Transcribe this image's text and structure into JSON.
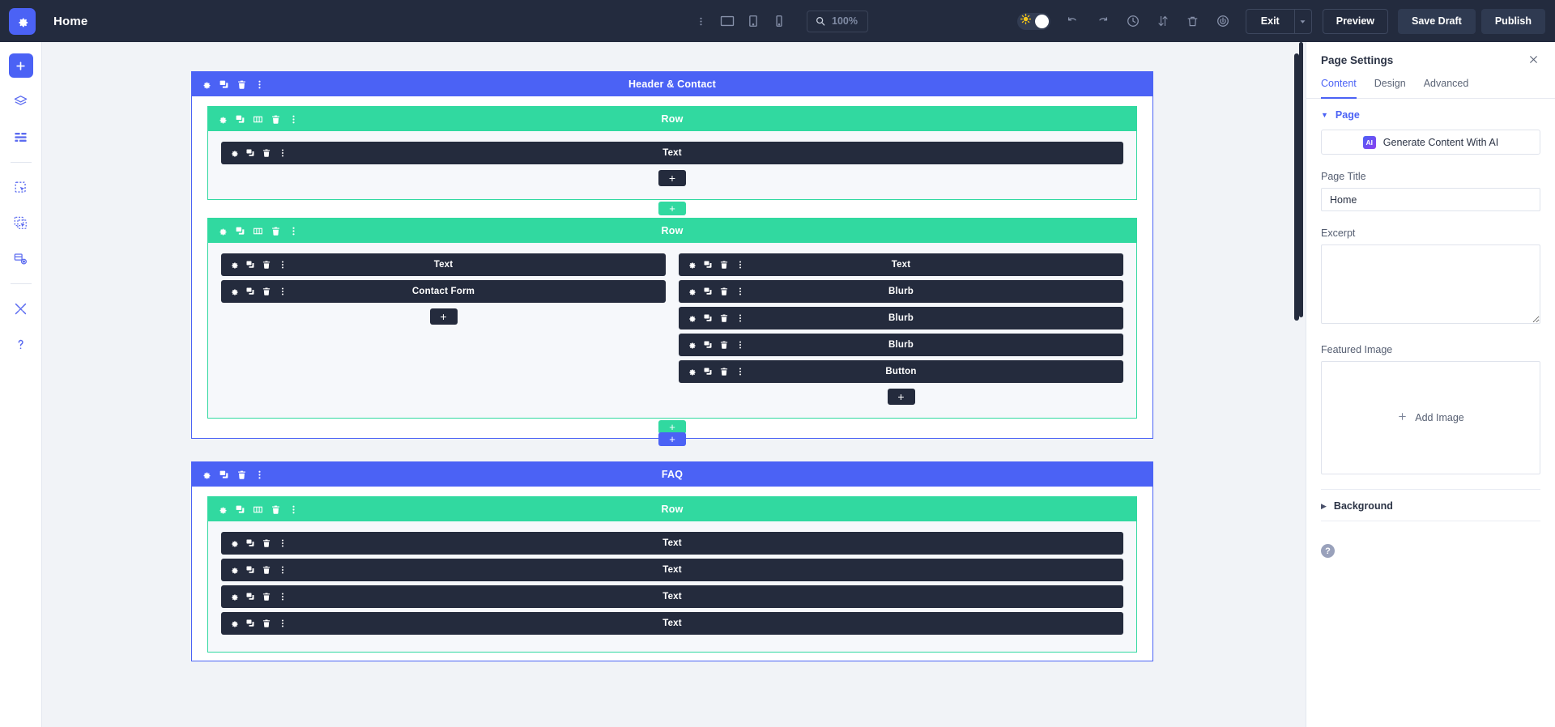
{
  "toolbar": {
    "logo_icon": "gear-icon",
    "page_name": "Home",
    "center": {
      "more_icon": "vertical-dots-icon",
      "desktop_icon": "desktop-view-icon",
      "tablet_icon": "tablet-view-icon",
      "phone_icon": "phone-view-icon",
      "zoom_icon": "search-zoom-icon",
      "zoom_value": "100%"
    },
    "right": {
      "theme_toggle_icon": "sun-moon-toggle",
      "undo_icon": "undo-icon",
      "redo_icon": "redo-icon",
      "history_icon": "clock-history-icon",
      "sort_icon": "sort-arrows-icon",
      "trash_icon": "trash-icon",
      "power_icon": "power-icon",
      "exit_label": "Exit",
      "exit_caret_icon": "chevron-down-icon",
      "preview_label": "Preview",
      "save_draft_label": "Save Draft",
      "publish_label": "Publish"
    }
  },
  "rail": {
    "items": [
      {
        "name": "add-new-icon",
        "glyph": "plus"
      },
      {
        "name": "layers-icon",
        "glyph": "layers"
      },
      {
        "name": "wireframe-icon",
        "glyph": "wireframe"
      },
      {
        "name": "select-element-icon",
        "glyph": "select"
      },
      {
        "name": "multi-select-icon",
        "glyph": "multiselect"
      },
      {
        "name": "save-library-icon",
        "glyph": "library"
      },
      {
        "name": "tools-icon",
        "glyph": "tools"
      },
      {
        "name": "help-icon",
        "glyph": "question"
      }
    ]
  },
  "icons": {
    "settings": "gear-icon",
    "duplicate": "duplicate-icon",
    "columns": "columns-icon",
    "delete": "trash-icon",
    "more": "vertical-dots-icon"
  },
  "canvas": {
    "add_module_label": "+",
    "add_row_label": "+",
    "add_section_label": "+",
    "sections": [
      {
        "label": "Header & Contact",
        "rows": [
          {
            "label": "Row",
            "columns": [
              {
                "modules": [
                  {
                    "label": "Text"
                  }
                ]
              }
            ]
          },
          {
            "label": "Row",
            "columns": [
              {
                "modules": [
                  {
                    "label": "Text"
                  },
                  {
                    "label": "Contact Form"
                  }
                ]
              },
              {
                "modules": [
                  {
                    "label": "Text"
                  },
                  {
                    "label": "Blurb"
                  },
                  {
                    "label": "Blurb"
                  },
                  {
                    "label": "Blurb"
                  },
                  {
                    "label": "Button"
                  }
                ]
              }
            ]
          }
        ]
      },
      {
        "label": "FAQ",
        "rows": [
          {
            "label": "Row",
            "columns": [
              {
                "modules": [
                  {
                    "label": "Text"
                  },
                  {
                    "label": "Text"
                  },
                  {
                    "label": "Text"
                  },
                  {
                    "label": "Text"
                  }
                ]
              }
            ]
          }
        ]
      }
    ]
  },
  "panel": {
    "title": "Page Settings",
    "close_icon": "close-icon",
    "tabs": [
      {
        "label": "Content",
        "active": true
      },
      {
        "label": "Design",
        "active": false
      },
      {
        "label": "Advanced",
        "active": false
      }
    ],
    "page_accordion": "Page",
    "ai_badge": "AI",
    "ai_button": "Generate Content With AI",
    "page_title_label": "Page Title",
    "page_title_value": "Home",
    "page_title_placeholder": "",
    "excerpt_label": "Excerpt",
    "excerpt_value": "",
    "excerpt_placeholder": "",
    "featured_image_label": "Featured Image",
    "add_image_label": "Add Image",
    "background_accordion": "Background",
    "help_glyph": "?"
  },
  "colors": {
    "toolbar_bg": "#232b3e",
    "section_blue": "#4b62f5",
    "row_green": "#31d9a0",
    "module_dark": "#242b3d",
    "canvas_bg": "#f1f3f7"
  }
}
